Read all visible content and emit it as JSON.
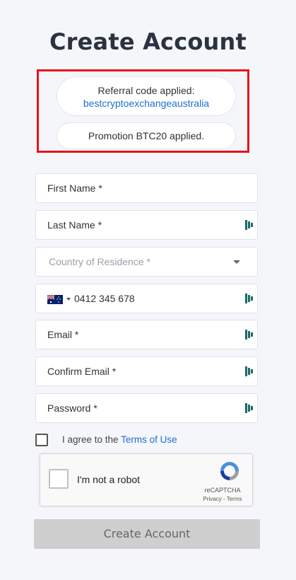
{
  "page": {
    "title": "Create Account"
  },
  "referral": {
    "label": "Referral code applied:",
    "code": "bestcryptoexchangeaustralia"
  },
  "promotion": {
    "text": "Promotion BTC20 applied."
  },
  "fields": {
    "first_name": "First Name *",
    "last_name": "Last Name *",
    "country": "Country of Residence *",
    "phone": "0412 345 678",
    "email": "Email *",
    "confirm_email": "Confirm Email *",
    "password": "Password *"
  },
  "agree": {
    "prefix": "I agree to the ",
    "link": "Terms of Use"
  },
  "recaptcha": {
    "label": "I'm not a robot",
    "brand": "reCAPTCHA",
    "links": "Privacy - Terms"
  },
  "submit": {
    "label": "Create Account"
  },
  "colors": {
    "highlight": "#e8121b",
    "link": "#1e6fd1",
    "button_disabled": "#cfcfcf"
  },
  "icons": {
    "field_manager": "password-manager-icon",
    "phone_flag": "australia-flag-icon"
  }
}
